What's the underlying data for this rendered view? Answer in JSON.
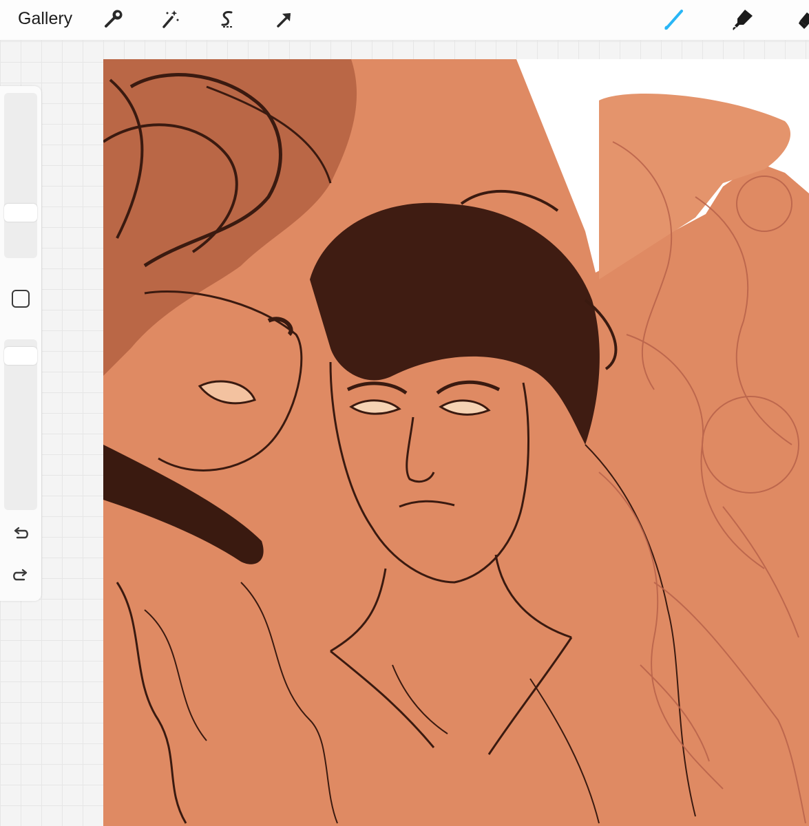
{
  "toolbar": {
    "gallery_label": "Gallery",
    "left_tools": [
      "wrench-icon",
      "magic-wand-icon",
      "selection-s-icon",
      "transform-arrow-icon"
    ],
    "right_tools": [
      "brush-icon",
      "smudge-icon",
      "eraser-icon"
    ],
    "active_tool": "brush",
    "active_color": "#29b6f6"
  },
  "sidebar": {
    "brush_size_level": 0.25,
    "opacity_level": 0.95,
    "buttons": [
      "modify-square-icon",
      "undo-icon",
      "redo-icon"
    ]
  },
  "canvas": {
    "background_color": "#df8a63",
    "line_color": "#3a1a10",
    "sketch_color": "#b8624a"
  }
}
